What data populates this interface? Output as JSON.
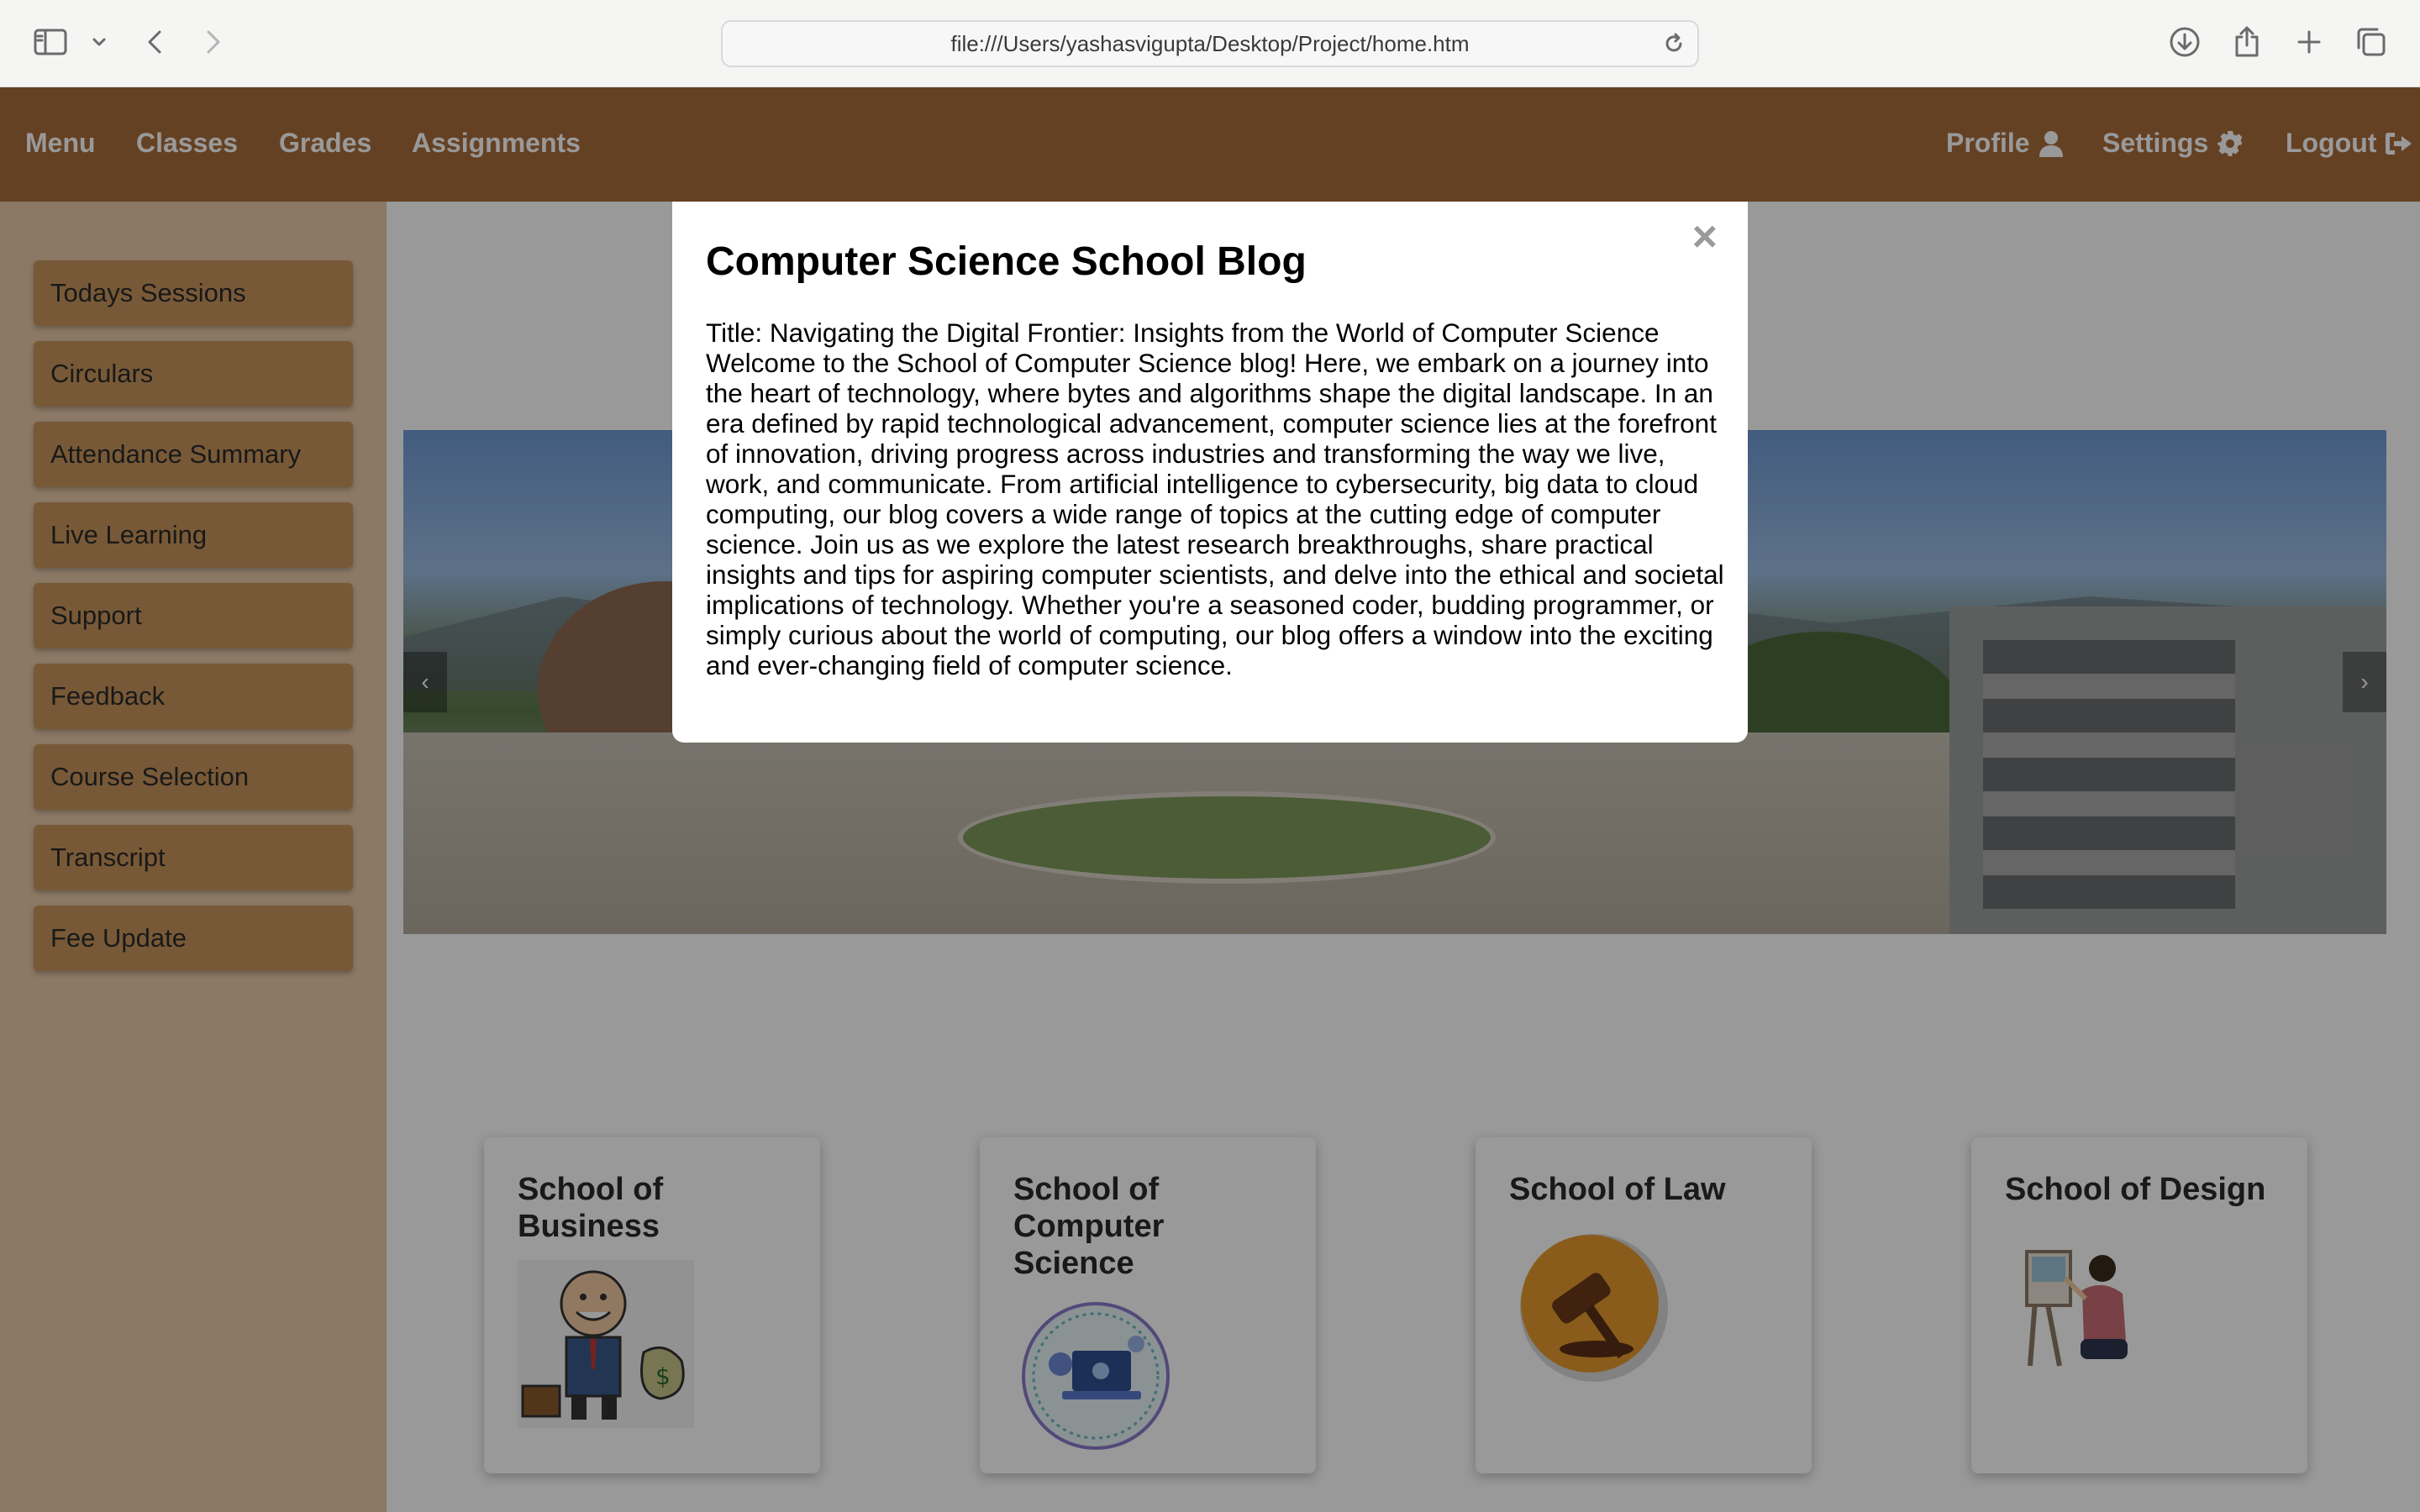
{
  "browser": {
    "url": "file:///Users/yashasvigupta/Desktop/Project/home.htm",
    "icons": [
      "sidebar-icon",
      "chevron-down-icon",
      "back-icon",
      "forward-icon",
      "reload-icon",
      "download-icon",
      "share-icon",
      "new-tab-icon",
      "tabs-overview-icon"
    ]
  },
  "nav": {
    "left": [
      "Menu",
      "Classes",
      "Grades",
      "Assignments"
    ],
    "profile": "Profile",
    "settings": "Settings",
    "logout": "Logout"
  },
  "sidebar": {
    "items": [
      "Todays Sessions",
      "Circulars",
      "Attendance Summary",
      "Live Learning",
      "Support",
      "Feedback",
      "Course Selection",
      "Transcript",
      "Fee Update"
    ]
  },
  "carousel": {
    "prev": "‹",
    "next": "›"
  },
  "schools": [
    {
      "title": "School of Business",
      "icon": "businessman-illustration"
    },
    {
      "title": "School of Computer Science",
      "icon": "computer-science-emblem"
    },
    {
      "title": "School of Law",
      "icon": "gavel-icon"
    },
    {
      "title": "School of Design",
      "icon": "painter-illustration"
    }
  ],
  "modal": {
    "close": "×",
    "title": "Computer Science School Blog",
    "body": "Title: Navigating the Digital Frontier: Insights from the World of Computer Science Welcome to the School of Computer Science blog! Here, we embark on a journey into the heart of technology, where bytes and algorithms shape the digital landscape. In an era defined by rapid technological advancement, computer science lies at the forefront of innovation, driving progress across industries and transforming the way we live, work, and communicate. From artificial intelligence to cybersecurity, big data to cloud computing, our blog covers a wide range of topics at the cutting edge of computer science. Join us as we explore the latest research breakthroughs, share practical insights and tips for aspiring computer scientists, and delve into the ethical and societal implications of technology. Whether you're a seasoned coder, budding programmer, or simply curious about the world of computing, our blog offers a window into the exciting and ever-changing field of computer science."
  },
  "colors": {
    "navbar": "#a86d3c",
    "sidebar": "#e8c9a8",
    "sidebar_button": "#c9955c"
  }
}
